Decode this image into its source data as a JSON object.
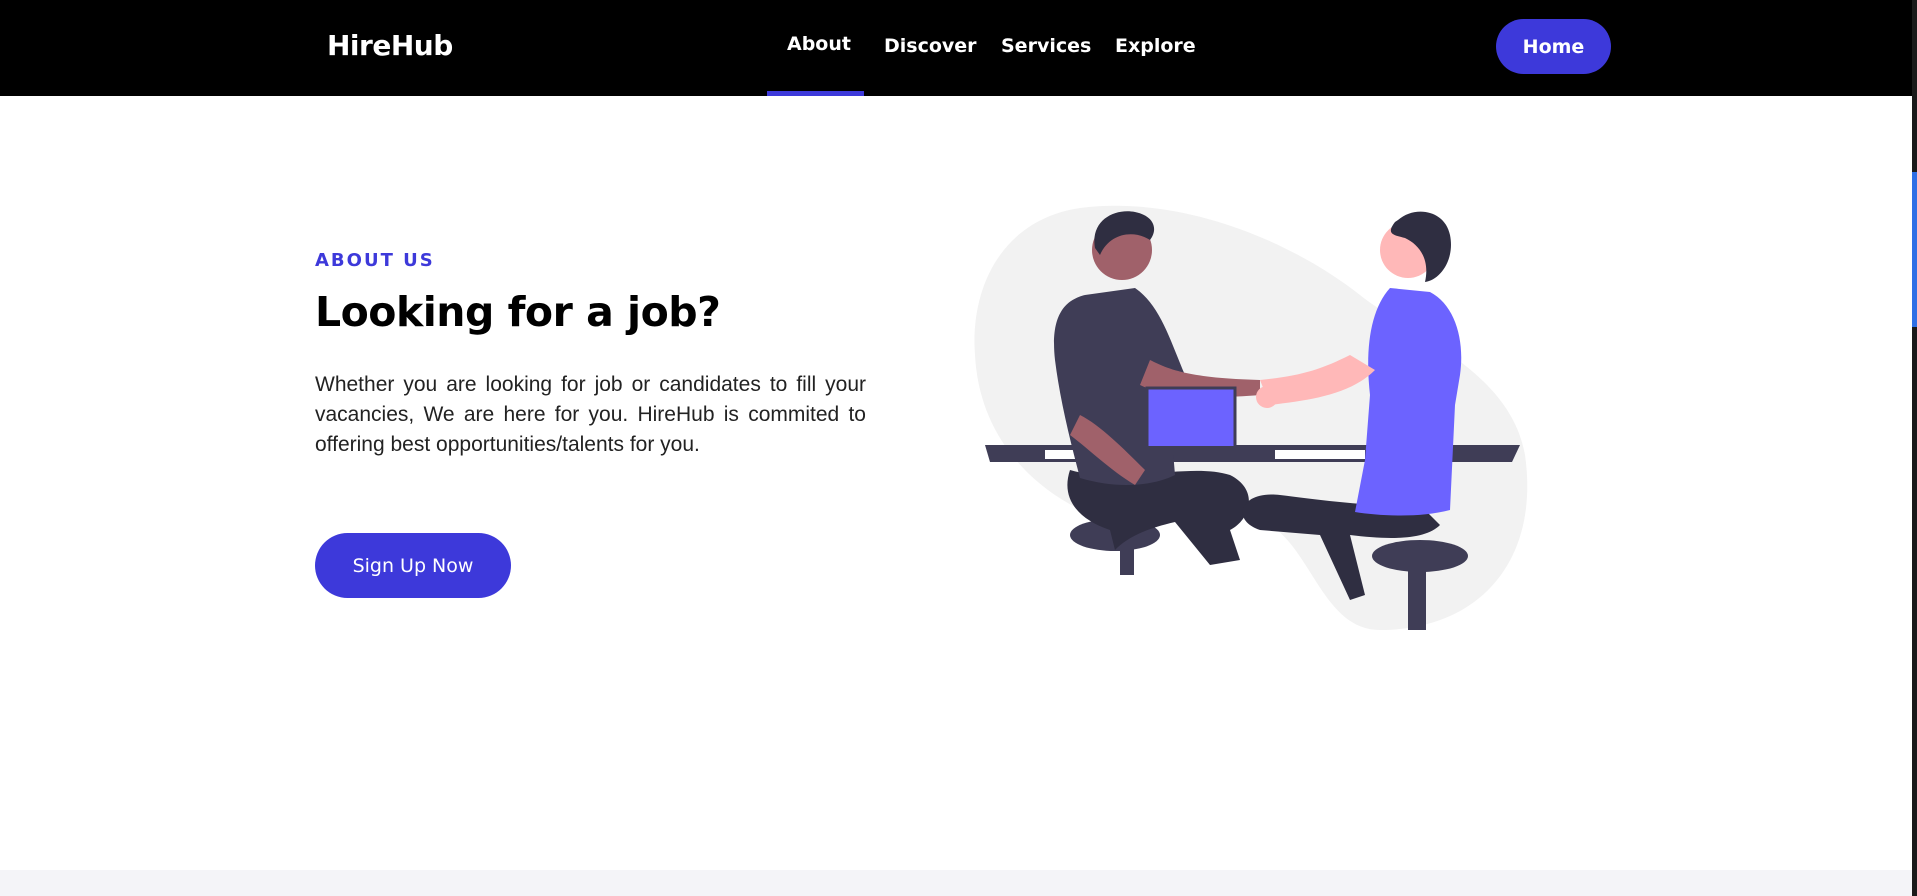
{
  "header": {
    "brand": "HireHub",
    "nav": [
      "About",
      "Discover",
      "Services",
      "Explore"
    ],
    "active_nav": "About",
    "home_button": "Home"
  },
  "hero": {
    "eyebrow": "ABOUT US",
    "title": "Looking for a job?",
    "description": "Whether you are looking for job or candidates to fill your vacancies, We are here for you. HireHub is commited to offering best opportunities/talents for you.",
    "cta": "Sign Up Now"
  },
  "colors": {
    "accent": "#3d39da",
    "header_bg": "#000000",
    "illustration_purple": "#6c63ff"
  },
  "illustration": {
    "name": "handshake-illustration"
  }
}
